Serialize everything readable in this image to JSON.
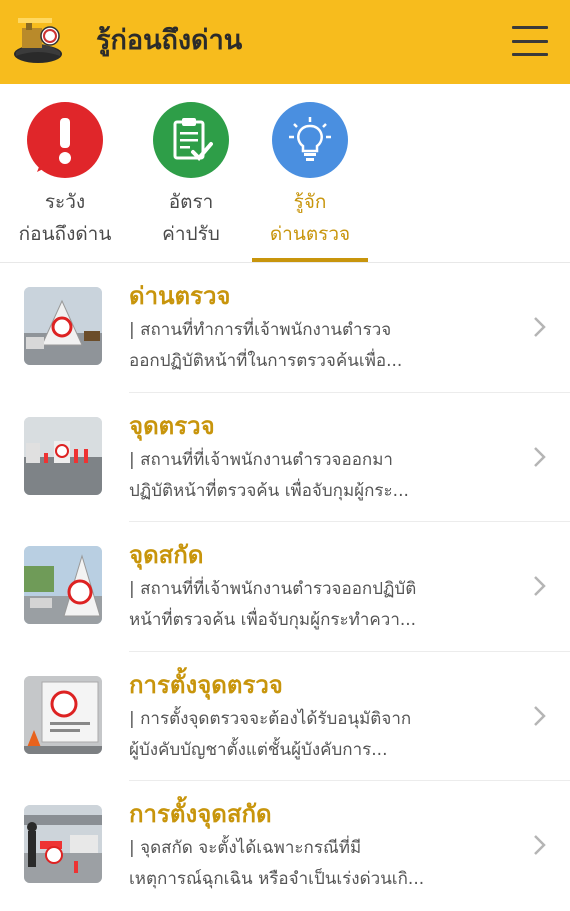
{
  "app": {
    "title": "รู้ก่อนถึงด่าน",
    "logo_icon": "highway-police-logo",
    "menu_icon": "hamburger-menu-icon",
    "accent_color": "#f7bc1d",
    "gold_text_color": "#c8950c"
  },
  "tabs": [
    {
      "line1": "ระวัง",
      "line2": "ก่อนถึงด่าน",
      "icon": "exclamation-icon",
      "color": "#e0262a",
      "active": false
    },
    {
      "line1": "อัตรา",
      "line2": "ค่าปรับ",
      "icon": "clipboard-check-icon",
      "color": "#2e9e48",
      "active": false
    },
    {
      "line1": "รู้จัก",
      "line2": "ด่านตรวจ",
      "icon": "lightbulb-icon",
      "color": "#4a8fe0",
      "active": true
    }
  ],
  "items": [
    {
      "title": "ด่านตรวจ",
      "line1": "| สถานที่ทำการที่เจ้าพนักงานตำรวจ",
      "line2": "ออกปฏิบัติหน้าที่ในการตรวจค้นเพื่อ..."
    },
    {
      "title": "จุดตรวจ",
      "line1": "| สถานที่ที่เจ้าพนักงานตำรวจออกมา",
      "line2": "ปฏิบัติหน้าที่ตรวจค้น เพื่อจับกุมผู้กระ..."
    },
    {
      "title": "จุดสกัด",
      "line1": "| สถานที่ที่เจ้าพนักงานตำรวจออกปฏิบัติ",
      "line2": "หน้าที่ตรวจค้น เพื่อจับกุมผู้กระทำควา..."
    },
    {
      "title": "การตั้งจุดตรวจ",
      "line1": "| การตั้งจุดตรวจจะต้องได้รับอนุมัติจาก",
      "line2": "ผู้บังคับบัญชาตั้งแต่ชั้นผู้บังคับการ..."
    },
    {
      "title": "การตั้งจุดสกัด",
      "line1": "| จุดสกัด จะตั้งได้เฉพาะกรณีที่มี",
      "line2": "เหตุการณ์ฉุกเฉิน หรือจำเป็นเร่งด่วนเกิ..."
    }
  ]
}
